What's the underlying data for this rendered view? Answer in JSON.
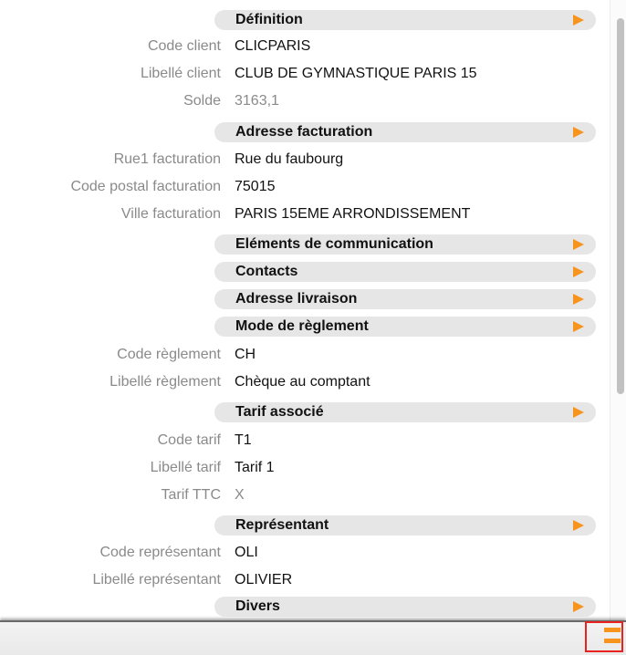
{
  "sections": [
    {
      "title": "Définition"
    },
    {
      "title": "Adresse facturation"
    },
    {
      "title": "Eléments de communication"
    },
    {
      "title": "Contacts"
    },
    {
      "title": "Adresse livraison"
    },
    {
      "title": "Mode de règlement"
    },
    {
      "title": "Tarif associé"
    },
    {
      "title": "Représentant"
    },
    {
      "title": "Divers"
    }
  ],
  "fields": {
    "code_client": {
      "label": "Code client",
      "value": "CLICPARIS"
    },
    "libelle_client": {
      "label": "Libellé client",
      "value": "CLUB DE GYMNASTIQUE PARIS 15"
    },
    "solde": {
      "label": "Solde",
      "value": "3163,1"
    },
    "rue1_facturation": {
      "label": "Rue1 facturation",
      "value": "Rue du faubourg"
    },
    "code_postal_facturation": {
      "label": "Code postal facturation",
      "value": "75015"
    },
    "ville_facturation": {
      "label": "Ville facturation",
      "value": "PARIS 15EME ARRONDISSEMENT"
    },
    "code_reglement": {
      "label": "Code règlement",
      "value": "CH"
    },
    "libelle_reglement": {
      "label": "Libellé règlement",
      "value": "Chèque au comptant"
    },
    "code_tarif": {
      "label": "Code tarif",
      "value": "T1"
    },
    "libelle_tarif": {
      "label": "Libellé tarif",
      "value": "Tarif 1"
    },
    "tarif_ttc": {
      "label": "Tarif TTC",
      "value": "X"
    },
    "code_representant": {
      "label": "Code représentant",
      "value": "OLI"
    },
    "libelle_representant": {
      "label": "Libellé représentant",
      "value": "OLIVIER"
    }
  },
  "colors": {
    "accent": "#f7941d",
    "section_bg": "#e6e6e6",
    "label": "#8a8a8a",
    "highlight_border": "#e8221e"
  },
  "icons": {
    "section_expand": "triangle-right-icon",
    "menu": "menu-icon"
  }
}
